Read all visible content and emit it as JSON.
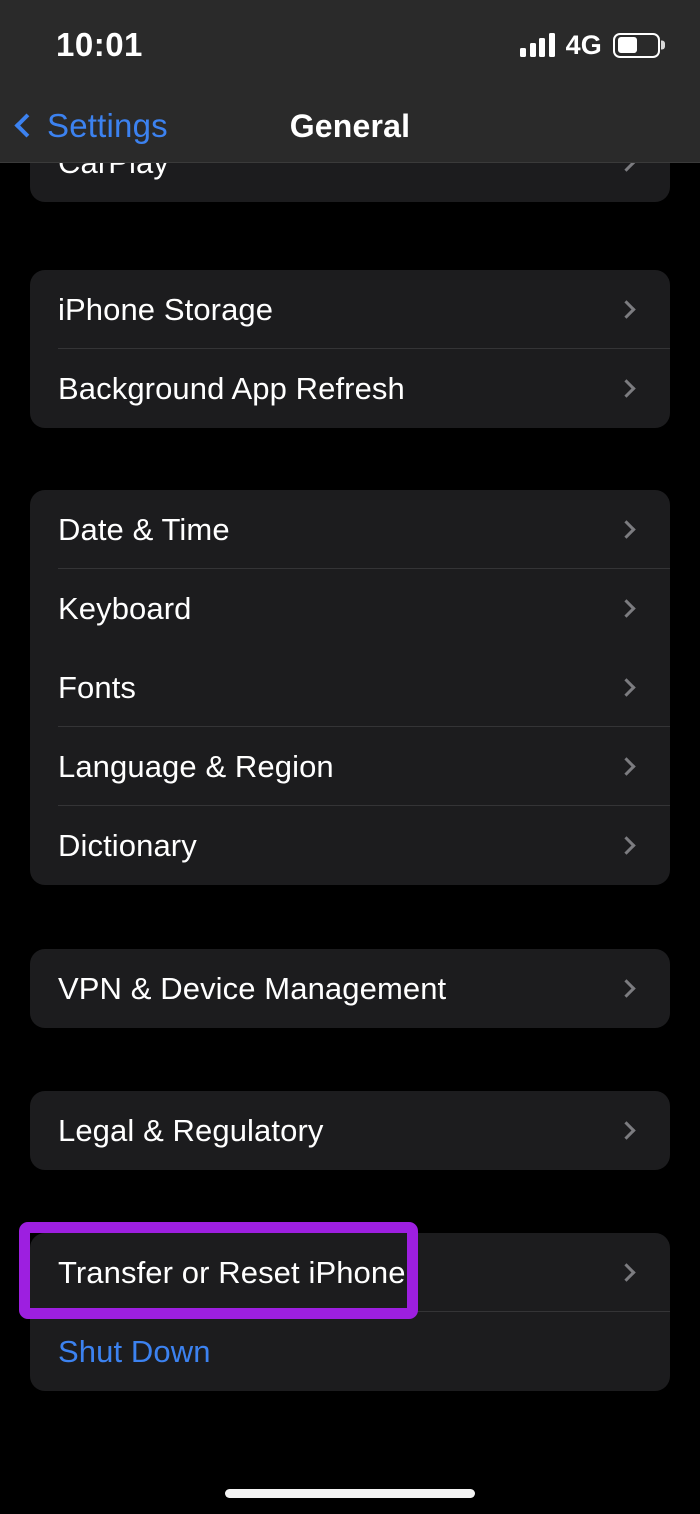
{
  "status_bar": {
    "time": "10:01",
    "network": "4G",
    "signal_bars_filled": 4,
    "signal_bars_total": 4,
    "battery_percent": 50,
    "icons": {
      "signal": "signal-bars-icon",
      "battery": "battery-icon"
    }
  },
  "nav_bar": {
    "back_label": "Settings",
    "title": "General",
    "back_icon": "chevron-left-icon",
    "accent_color": "#3c82f0"
  },
  "colors": {
    "page_background": "#000000",
    "card_background": "#1c1c1e",
    "bar_background": "#2a2a2a",
    "divider": "#343436",
    "text_primary": "#ffffff",
    "accent_blue": "#3c82f0",
    "chevron_gray": "#7c7c80",
    "highlight_purple": "#9d1fe0"
  },
  "sections": [
    {
      "id": "section-carplay",
      "clipped_top": true,
      "rows": [
        {
          "label": "CarPlay",
          "name": "carplay",
          "chevron": true,
          "accent": false,
          "divider": false
        }
      ]
    },
    {
      "id": "section-storage",
      "clipped_top": false,
      "rows": [
        {
          "label": "iPhone Storage",
          "name": "iphone-storage",
          "chevron": true,
          "accent": false,
          "divider": true
        },
        {
          "label": "Background App Refresh",
          "name": "background-app-refresh",
          "chevron": true,
          "accent": false,
          "divider": false
        }
      ]
    },
    {
      "id": "section-datetime",
      "clipped_top": false,
      "rows": [
        {
          "label": "Date & Time",
          "name": "date-and-time",
          "chevron": true,
          "accent": false,
          "divider": true
        },
        {
          "label": "Keyboard",
          "name": "keyboard",
          "chevron": true,
          "accent": false,
          "divider": false
        },
        {
          "label": "Fonts",
          "name": "fonts",
          "chevron": true,
          "accent": false,
          "divider": true
        },
        {
          "label": "Language & Region",
          "name": "language-and-region",
          "chevron": true,
          "accent": false,
          "divider": true
        },
        {
          "label": "Dictionary",
          "name": "dictionary",
          "chevron": true,
          "accent": false,
          "divider": false
        }
      ]
    },
    {
      "id": "section-vpn",
      "clipped_top": false,
      "rows": [
        {
          "label": "VPN & Device Management",
          "name": "vpn-and-device-management",
          "chevron": true,
          "accent": false,
          "divider": false
        }
      ]
    },
    {
      "id": "section-legal",
      "clipped_top": false,
      "rows": [
        {
          "label": "Legal & Regulatory",
          "name": "legal-and-regulatory",
          "chevron": true,
          "accent": false,
          "divider": false
        }
      ]
    },
    {
      "id": "section-reset",
      "clipped_top": false,
      "rows": [
        {
          "label": "Transfer or Reset iPhone",
          "name": "transfer-or-reset-iphone",
          "chevron": true,
          "accent": false,
          "divider": true
        },
        {
          "label": "Shut Down",
          "name": "shut-down",
          "chevron": false,
          "accent": true,
          "divider": false
        }
      ]
    }
  ],
  "annotation": {
    "target_row": "Transfer or Reset iPhone",
    "color": "#9d1fe0"
  },
  "home_indicator": {
    "name": "home-indicator"
  }
}
